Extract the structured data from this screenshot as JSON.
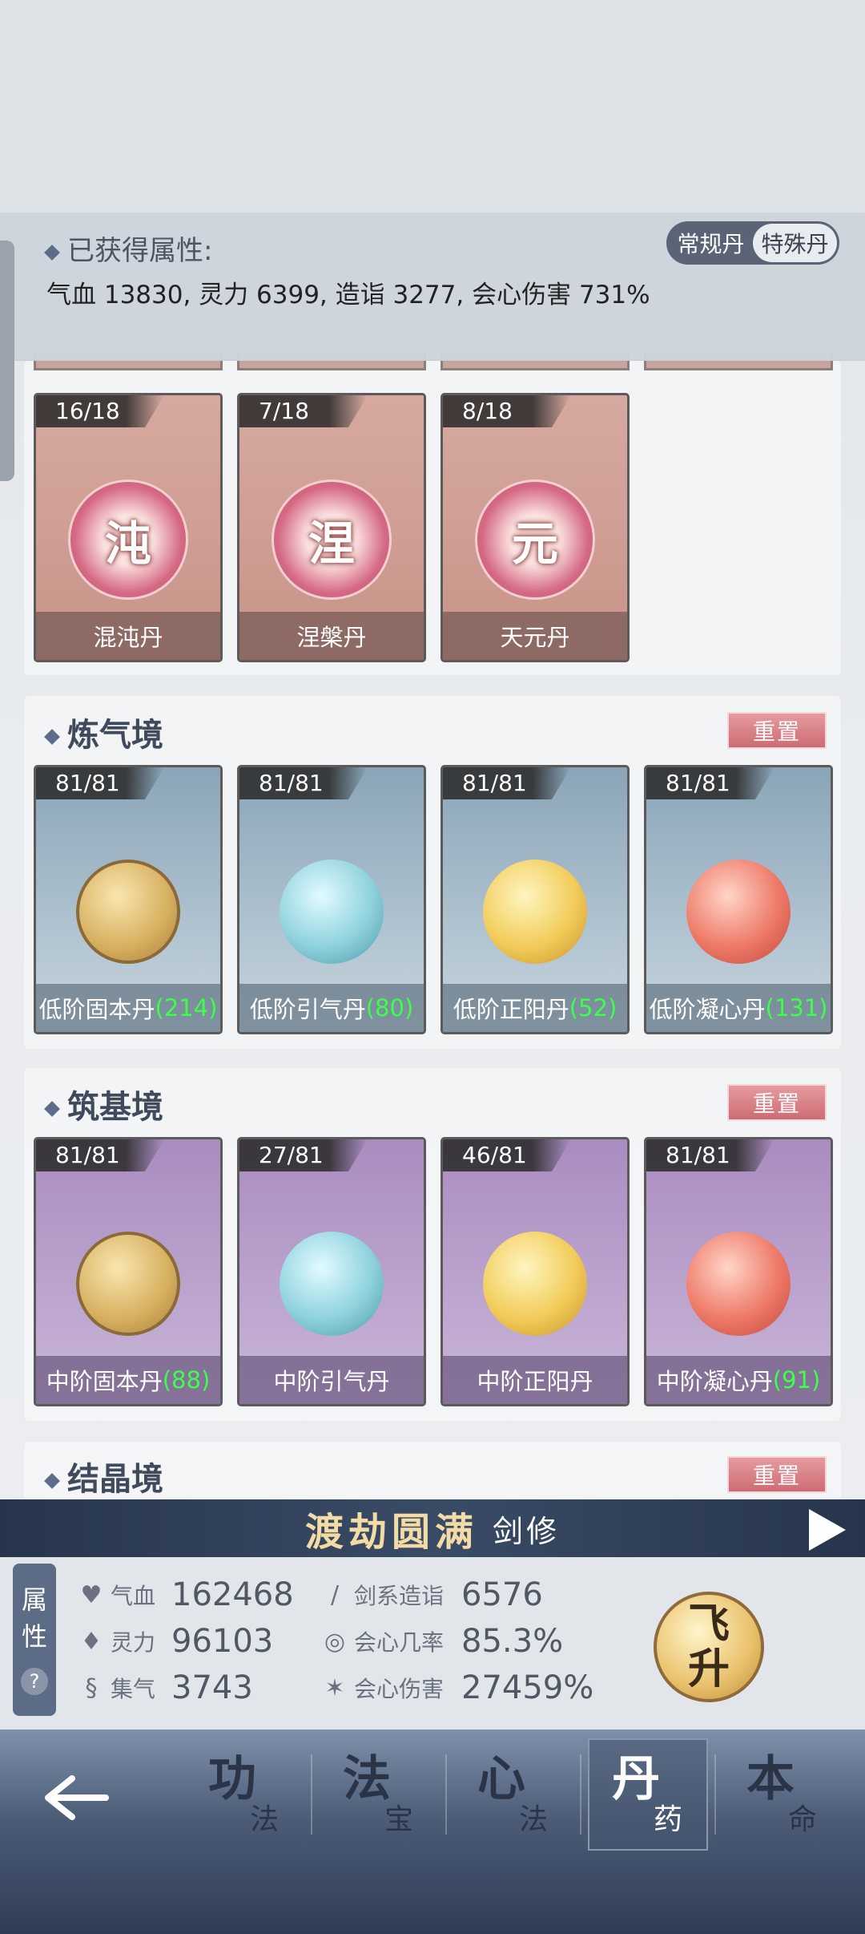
{
  "attributes": {
    "title": "已获得属性:",
    "values": "气血 13830, 灵力 6399, 造诣 3277, 会心伤害 731%"
  },
  "dan_type": {
    "regular": "常规丹",
    "special": "特殊丹"
  },
  "special_cards": [
    {
      "count": "16/18",
      "rune": "沌",
      "name": "混沌丹"
    },
    {
      "count": "7/18",
      "rune": "涅",
      "name": "涅槃丹"
    },
    {
      "count": "8/18",
      "rune": "元",
      "name": "天元丹"
    }
  ],
  "sections": [
    {
      "title": "炼气境",
      "reset": "重置",
      "cards": [
        {
          "count": "81/81",
          "name": "低阶固本丹",
          "amount": "(214)",
          "orb": "gold"
        },
        {
          "count": "81/81",
          "name": "低阶引气丹",
          "amount": "(80)",
          "orb": "teal"
        },
        {
          "count": "81/81",
          "name": "低阶正阳丹",
          "amount": "(52)",
          "orb": "yellow"
        },
        {
          "count": "81/81",
          "name": "低阶凝心丹",
          "amount": "(131)",
          "orb": "red"
        }
      ]
    },
    {
      "title": "筑基境",
      "reset": "重置",
      "cards": [
        {
          "count": "81/81",
          "name": "中阶固本丹",
          "amount": "(88)",
          "orb": "gold"
        },
        {
          "count": "27/81",
          "name": "中阶引气丹",
          "amount": "",
          "orb": "teal"
        },
        {
          "count": "46/81",
          "name": "中阶正阳丹",
          "amount": "",
          "orb": "yellow"
        },
        {
          "count": "81/81",
          "name": "中阶凝心丹",
          "amount": "(91)",
          "orb": "red"
        }
      ]
    },
    {
      "title": "结晶境",
      "reset": "重置"
    }
  ],
  "realm": {
    "title": "渡劫圆满",
    "class": "剑修"
  },
  "stats": {
    "tab_label_1": "属",
    "tab_label_2": "性",
    "help": "?",
    "left": [
      {
        "label": "气血",
        "value": "162468",
        "icon": "heart-icon"
      },
      {
        "label": "灵力",
        "value": "96103",
        "icon": "flame-icon"
      },
      {
        "label": "集气",
        "value": "3743",
        "icon": "swirl-icon"
      }
    ],
    "right": [
      {
        "label": "剑系造诣",
        "value": "6576",
        "icon": "sword-icon"
      },
      {
        "label": "会心几率",
        "value": "85.3%",
        "icon": "crit-rate-icon"
      },
      {
        "label": "会心伤害",
        "value": "27459%",
        "icon": "crit-damage-icon"
      }
    ],
    "ascend_1": "飞",
    "ascend_2": "升"
  },
  "nav": [
    {
      "main": "功",
      "sub": "法"
    },
    {
      "main": "法",
      "sub": "宝"
    },
    {
      "main": "心",
      "sub": "法"
    },
    {
      "main": "丹",
      "sub": "药"
    },
    {
      "main": "本",
      "sub": "命"
    }
  ]
}
